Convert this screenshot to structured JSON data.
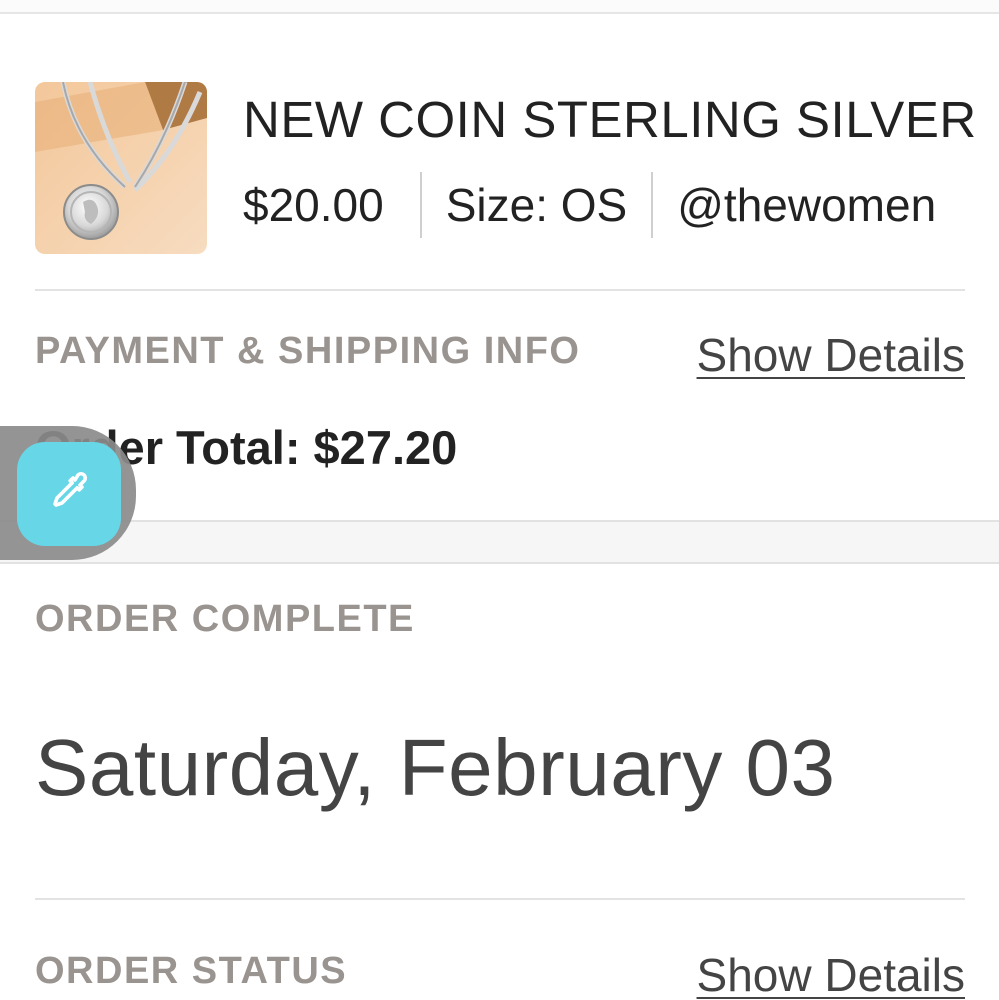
{
  "item": {
    "title": "NEW COIN STERLING SILVER",
    "price": "$20.00",
    "size": "Size: OS",
    "seller": "@thewomen"
  },
  "payment": {
    "section_label": "PAYMENT & SHIPPING INFO",
    "show_details_label": "Show Details",
    "order_total_label": "Order Total:",
    "order_total_value": "$27.20"
  },
  "order_complete": {
    "section_label": "ORDER COMPLETE",
    "date": "Saturday, February 03"
  },
  "order_status": {
    "section_label": "ORDER STATUS",
    "show_details_label": "Show Details"
  },
  "icons": {
    "color_picker": "eyedropper-icon"
  },
  "colors": {
    "picker_accent": "#67d6e6",
    "label_gray": "#9a9490"
  }
}
